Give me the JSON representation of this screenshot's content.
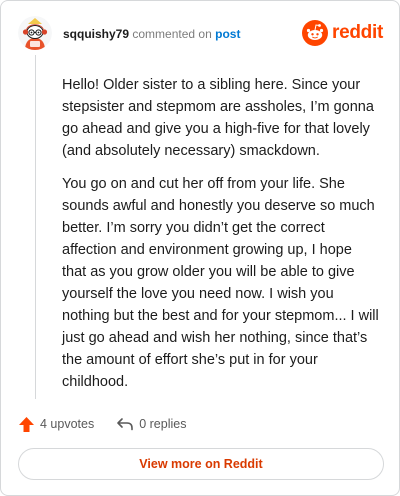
{
  "comment": {
    "username": "sqquishy79",
    "action": "commented on",
    "post_link": "post",
    "paragraphs": [
      "Hello! Older sister to a sibling here. Since your stepsister and stepmom are assholes, I’m gonna go ahead and give you a high-five for that lovely (and absolutely necessary) smackdown.",
      "You go on and cut her off from your life. She sounds awful and honestly you deserve so much better. I’m sorry you didn’t get the correct affection and environment growing up, I hope that as you grow older you will be able to give yourself the love you need now. I wish you nothing but the best and for your stepmom... I will just go ahead and wish her nothing, since that’s the amount of effort she’s put in for your childhood."
    ]
  },
  "brand": {
    "wordmark": "reddit",
    "icon": "reddit-snoo-icon"
  },
  "footer": {
    "upvotes": "4 upvotes",
    "replies": "0 replies",
    "upvote_icon": "upvote-arrow-icon",
    "reply_icon": "reply-arrow-icon"
  },
  "cta": {
    "label": "View more on Reddit"
  },
  "colors": {
    "brand": "#ff4500",
    "link": "#0079d3",
    "cta_text": "#d93a00",
    "border": "#d6d8da",
    "upvote": "#ff4500"
  }
}
